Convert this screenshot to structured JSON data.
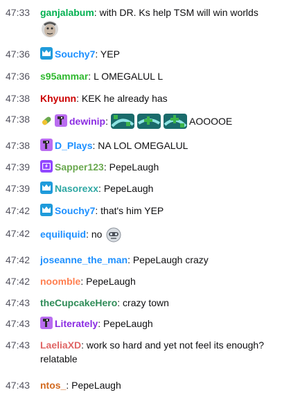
{
  "messages": [
    {
      "time": "47:33",
      "user": "ganjalabum",
      "text": "with DR. Ks help TSM will win worlds"
    },
    {
      "time": "47:36",
      "user": "Souchy7",
      "text": "YEP"
    },
    {
      "time": "47:36",
      "user": "s95ammar",
      "text": "L OMEGALUL L"
    },
    {
      "time": "47:38",
      "user": "Khyunn",
      "text": "KEK he already has"
    },
    {
      "time": "47:38",
      "user": "dewinip",
      "text": "AOOOOE"
    },
    {
      "time": "47:38",
      "user": "D_Plays",
      "text": "NA LOL OMEGALUL"
    },
    {
      "time": "47:39",
      "user": "Sapper123",
      "text": "PepeLaugh"
    },
    {
      "time": "47:39",
      "user": "Nasorexx",
      "text": "PepeLaugh"
    },
    {
      "time": "47:42",
      "user": "Souchy7",
      "text": "that's him YEP"
    },
    {
      "time": "47:42",
      "user": "equiliquid",
      "text": "no"
    },
    {
      "time": "47:42",
      "user": "joseanne_the_man",
      "text": "PepeLaugh crazy"
    },
    {
      "time": "47:42",
      "user": "noomble",
      "text": "PepeLaugh"
    },
    {
      "time": "47:43",
      "user": "theCupcakeHero",
      "text": "crazy town"
    },
    {
      "time": "47:43",
      "user": "Literately",
      "text": "PepeLaugh"
    },
    {
      "time": "47:43",
      "user": "LaeliaXD",
      "text": "work so hard and yet not feel its enough? relatable"
    },
    {
      "time": "47:43",
      "user": "ntos_",
      "text": "PepeLaugh"
    }
  ],
  "colors": {
    "timestamp": "#53535f",
    "text": "#0e0e10",
    "crown_badge": "#1f9bdb",
    "dino_badge": "#b96cf0",
    "prime_badge": "#9146ff"
  }
}
